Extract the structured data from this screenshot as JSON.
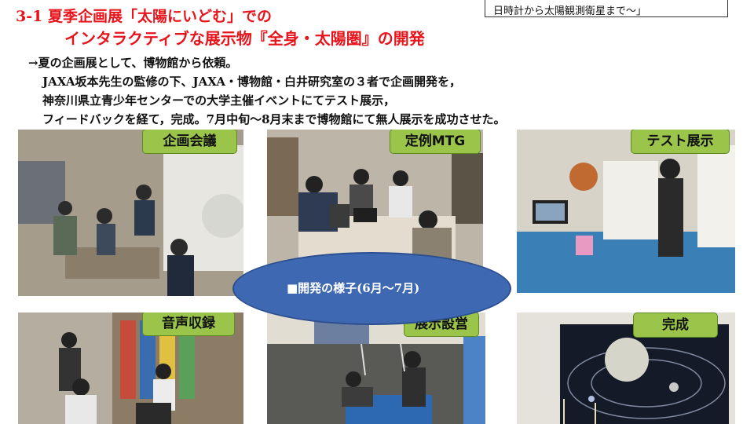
{
  "subtitle_box": "日時計から太陽観測衛星まで～」",
  "title": {
    "line1": "3-1 夏季企画展「太陽にいどむ」での",
    "line2": "インタラクティブな展示物『全身・太陽圏』の開発"
  },
  "body": {
    "line1": "→夏の企画展として、博物館から依頼。",
    "line2": "JAXA坂本先生の監修の下、JAXA・博物館・白井研究室の３者で企画開発を，",
    "line3": "神奈川県立青少年センターでの大学主催イベントにてテスト展示，",
    "line4": "フィードバックを経て，完成。7月中旬～8月末まで博物館にて無人展示を成功させた。"
  },
  "photos": {
    "p1": "企画会議",
    "p2": "定例MTG",
    "p3": "テスト展示",
    "p4": "音声収録",
    "p5": "展示設営",
    "p6": "完成"
  },
  "ellipse_label": "■開発の様子(6月～7月)",
  "colors": {
    "title_red": "#e8141b",
    "label_green": "#9bc54a",
    "ellipse_blue": "#3f68b3"
  }
}
